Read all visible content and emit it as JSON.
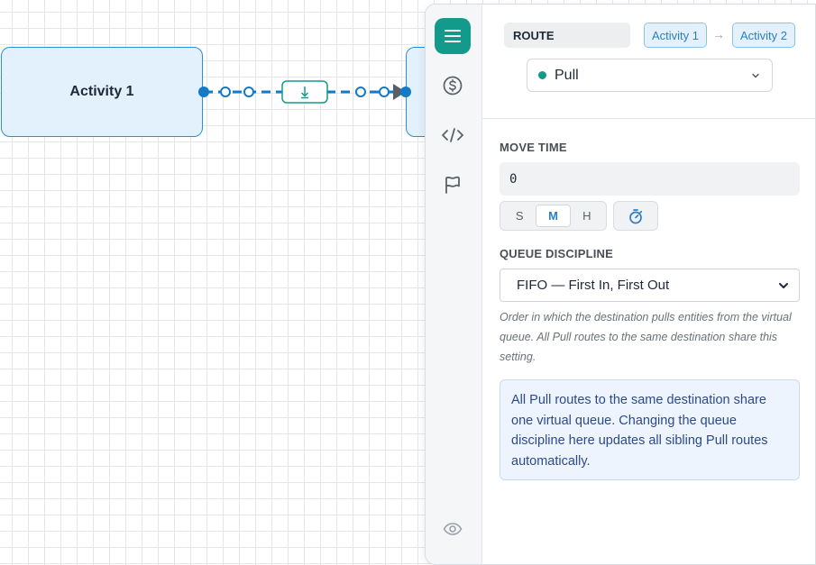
{
  "canvas": {
    "source_node": {
      "label": "Activity 1"
    },
    "target_node": {
      "label": ""
    },
    "connector": {
      "icon": "download-arrow-icon",
      "color": "#147ac8"
    }
  },
  "sidebar_rail": {
    "items": [
      {
        "icon": "menu-icon",
        "active": true
      },
      {
        "icon": "dollar-icon",
        "active": false
      },
      {
        "icon": "code-icon",
        "active": false
      },
      {
        "icon": "flag-icon",
        "active": false
      },
      {
        "icon": "eye-icon",
        "active": false
      }
    ]
  },
  "route": {
    "section_label": "ROUTE",
    "from": "Activity 1",
    "arrow": "→",
    "to": "Activity 2",
    "type": {
      "value": "Pull",
      "color": "#149a8a"
    }
  },
  "move_time": {
    "title": "MOVE TIME",
    "value": "0",
    "units": [
      "S",
      "M",
      "H"
    ],
    "selected_unit": "M"
  },
  "queue_discipline": {
    "title": "QUEUE DISCIPLINE",
    "selected": "FIFO — First In, First Out",
    "help": "Order in which the destination pulls entities from the virtual queue. All Pull routes to the same destination share this setting.",
    "note": "All Pull routes to the same destination share one virtual queue. Changing the queue discipline here updates all sibling Pull routes automatically."
  },
  "colors": {
    "accent": "#149a8a",
    "link": "#2b7fc4",
    "node_fill": "#e2f1fc",
    "node_border": "#2b8fd6"
  }
}
